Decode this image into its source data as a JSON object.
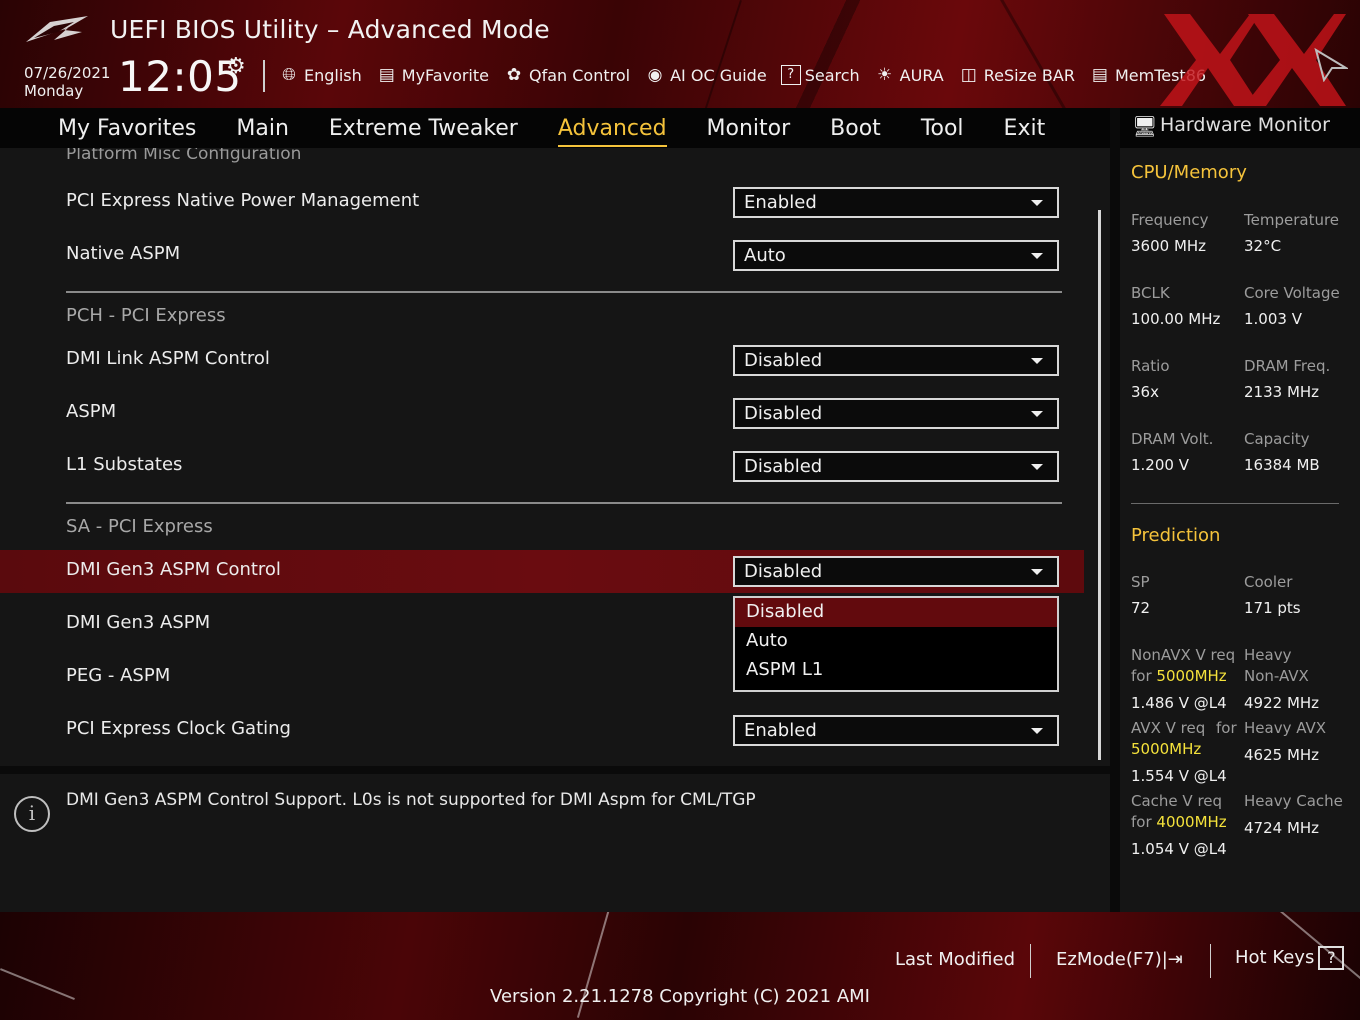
{
  "header": {
    "title": "UEFI BIOS Utility – Advanced Mode",
    "date": "07/26/2021",
    "day": "Monday",
    "time": "12:05",
    "tools": [
      {
        "label": "English",
        "icon": "globe-icon"
      },
      {
        "label": "MyFavorite",
        "icon": "favorite-icon"
      },
      {
        "label": "Qfan Control",
        "icon": "fan-icon"
      },
      {
        "label": "AI OC Guide",
        "icon": "ai-guide-icon"
      },
      {
        "label": "Search",
        "icon": "search-icon"
      },
      {
        "label": "AURA",
        "icon": "aura-icon"
      },
      {
        "label": "ReSize BAR",
        "icon": "resize-bar-icon"
      },
      {
        "label": "MemTest86",
        "icon": "memtest-icon"
      }
    ]
  },
  "tabs": [
    "My Favorites",
    "Main",
    "Extreme Tweaker",
    "Advanced",
    "Monitor",
    "Boot",
    "Tool",
    "Exit"
  ],
  "active_tab": "Advanced",
  "content": {
    "cut_title": "Platform Misc Configuration",
    "rows": [
      {
        "label": "PCI Express Native Power Management",
        "value": "Enabled"
      },
      {
        "label": "Native ASPM",
        "value": "Auto"
      },
      {
        "group": "PCH - PCI Express"
      },
      {
        "label": "DMI Link ASPM Control",
        "value": "Disabled"
      },
      {
        "label": "ASPM",
        "value": "Disabled"
      },
      {
        "label": "L1 Substates",
        "value": "Disabled"
      },
      {
        "group": "SA - PCI Express"
      },
      {
        "label": "DMI Gen3 ASPM Control",
        "value": "Disabled"
      },
      {
        "label": "DMI Gen3 ASPM",
        "value": ""
      },
      {
        "label": "PEG - ASPM",
        "value": ""
      },
      {
        "label": "PCI Express Clock Gating",
        "value": "Enabled"
      }
    ],
    "dropdown_options": [
      "Disabled",
      "Auto",
      "ASPM L1"
    ],
    "dropdown_selected": "Disabled"
  },
  "info": {
    "text": "DMI Gen3 ASPM Control Support. L0s is not supported for DMI Aspm for CML/TGP"
  },
  "hw_monitor": {
    "title": "Hardware Monitor",
    "cpu_section": "CPU/Memory",
    "cpu": {
      "frequency_label": "Frequency",
      "frequency": "3600 MHz",
      "temperature_label": "Temperature",
      "temperature": "32°C",
      "bclk_label": "BCLK",
      "bclk": "100.00 MHz",
      "core_voltage_label": "Core Voltage",
      "core_voltage": "1.003 V",
      "ratio_label": "Ratio",
      "ratio": "36x",
      "dram_freq_label": "DRAM Freq.",
      "dram_freq": "2133 MHz",
      "dram_volt_label": "DRAM Volt.",
      "dram_volt": "1.200 V",
      "capacity_label": "Capacity",
      "capacity": "16384 MB"
    },
    "prediction_section": "Prediction",
    "prediction": {
      "sp_label": "SP",
      "sp": "72",
      "cooler_label": "Cooler",
      "cooler": "171 pts",
      "nonavx_label_1": "NonAVX V req",
      "nonavx_label_2a": "for ",
      "nonavx_freq": "5000MHz",
      "nonavx_value": "1.486 V @L4",
      "heavy_nonavx_label_1": "Heavy",
      "heavy_nonavx_label_2": "Non-AVX",
      "heavy_nonavx_value": "4922 MHz",
      "avx_label": "AVX V req",
      "avx_for": "for",
      "avx_freq": "5000MHz",
      "avx_value": "1.554 V @L4",
      "heavy_avx_label": "Heavy AVX",
      "heavy_avx_value": "4625 MHz",
      "cache_label": "Cache V req",
      "cache_for": "for ",
      "cache_freq": "4000MHz",
      "cache_value": "1.054 V @L4",
      "heavy_cache_label": "Heavy Cache",
      "heavy_cache_value": "4724 MHz"
    }
  },
  "footer": {
    "last_modified": "Last Modified",
    "ezmode": "EzMode(F7)|",
    "hotkeys": "Hot Keys",
    "hotkeys_key": "?",
    "version": "Version 2.21.1278 Copyright (C) 2021 AMI"
  },
  "colors": {
    "accent": "#f5c33b",
    "highlight_row": "#620a0d",
    "brand_red": "#c4141a"
  }
}
